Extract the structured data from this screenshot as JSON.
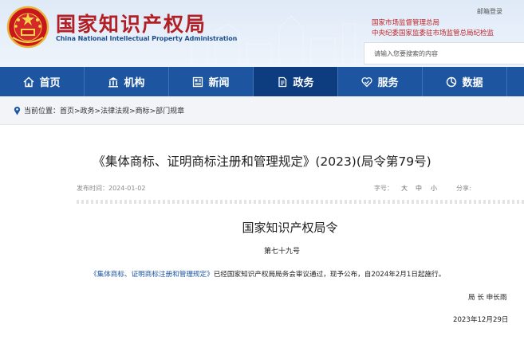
{
  "header": {
    "logo_cn": "国家知识产权局",
    "logo_en": "China National Intellectual Property Administration",
    "login_link": "邮箱登录",
    "affiliation_1": "国家市场监督管理总局",
    "affiliation_2": "中央纪委国家监委驻市场监管总局纪检监",
    "search_placeholder": "请输入您要搜索的内容"
  },
  "nav": {
    "items": [
      {
        "label": "首页",
        "icon": "home-icon"
      },
      {
        "label": "机构",
        "icon": "institution-icon"
      },
      {
        "label": "新闻",
        "icon": "news-icon"
      },
      {
        "label": "政务",
        "icon": "document-icon"
      },
      {
        "label": "服务",
        "icon": "service-icon"
      },
      {
        "label": "数据",
        "icon": "data-pie-icon"
      }
    ],
    "active": "政务"
  },
  "breadcrumb": {
    "text": "当前位置：首页>政务>法律法规>商标>部门规章"
  },
  "article": {
    "title": "《集体商标、证明商标注册和管理规定》(2023)(局令第79号)",
    "publish_date": "发布时间：2024-01-02",
    "font_size_label": "字号：",
    "font_size_big": "大",
    "font_size_mid": "中",
    "font_size_small": "小",
    "share_label": "分享:",
    "doc_title": "国家知识产权局令",
    "order_no": "第七十九号",
    "body_link": "《集体商标、证明商标注册和管理规定》",
    "body_rest": "已经国家知识产权局局务会审议通过，现予公布，自2024年2月1日起施行。",
    "signature": "局 长  申长雨",
    "sign_date": "2023年12月29日"
  },
  "colors": {
    "brand_red": "#b21f25",
    "nav_blue": "#1d55a0",
    "nav_active": "#0d3d7e"
  }
}
